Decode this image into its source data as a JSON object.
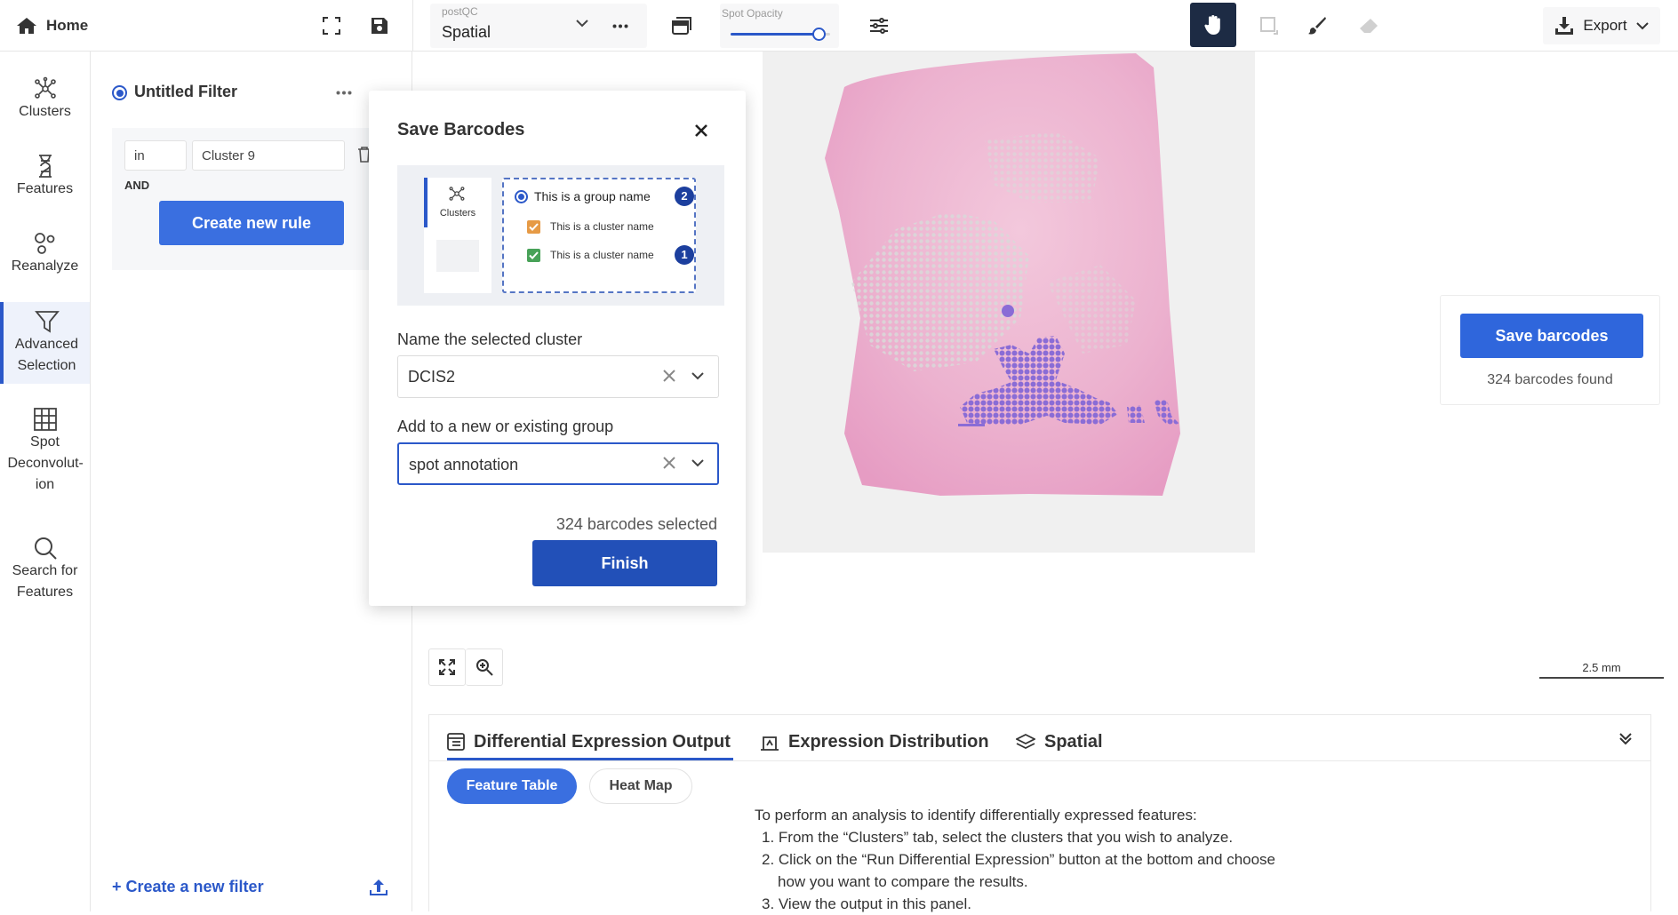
{
  "topbar": {
    "home_label": "Home",
    "dataset_caption": "postQC",
    "view_value": "Spatial",
    "spot_opacity_label": "Spot Opacity",
    "spot_opacity_level": 0.88,
    "export_label": "Export"
  },
  "leftnav": {
    "items": [
      {
        "label": "Clusters",
        "icon": "clusters-icon"
      },
      {
        "label": "Features",
        "icon": "features-icon"
      },
      {
        "label": "Reanalyze",
        "icon": "reanalyze-icon"
      },
      {
        "label": "Advanced Selection",
        "icon": "filter-icon"
      },
      {
        "label": "Spot Deconvolut-ion",
        "icon": "grid-icon"
      },
      {
        "label": "Search for Features",
        "icon": "search-icon"
      }
    ]
  },
  "filter": {
    "title": "Untitled Filter",
    "rule_operator": "in",
    "rule_value": "Cluster 9",
    "conjunction": "AND",
    "create_rule_label": "Create new rule",
    "create_filter_label": "+ Create a new filter"
  },
  "modal": {
    "title": "Save Barcodes",
    "illustration": {
      "tab_label": "Clusters",
      "group_name": "This is a group name",
      "cluster_name_1": "This is a cluster name",
      "cluster_name_2": "This is a cluster name",
      "badge_group": "2",
      "badge_cluster": "1"
    },
    "cluster_name_label": "Name the selected cluster",
    "cluster_name_value": "DCIS2",
    "group_label": "Add to a new or existing group",
    "group_value": "spot annotation",
    "selected_count": "324 barcodes selected",
    "finish_label": "Finish"
  },
  "save_card": {
    "button_label": "Save barcodes",
    "found_text": "324 barcodes found"
  },
  "scalebar": {
    "label": "2.5 mm"
  },
  "bottom": {
    "tabs": [
      {
        "label": "Differential Expression Output",
        "active": true
      },
      {
        "label": "Expression Distribution",
        "active": false
      },
      {
        "label": "Spatial",
        "active": false
      }
    ],
    "chips": [
      {
        "label": "Feature Table",
        "active": true
      },
      {
        "label": "Heat Map",
        "active": false
      }
    ],
    "instructions": {
      "intro": "To perform an analysis to identify differentially expressed features:",
      "step1": "1. From the “Clusters” tab, select the clusters that you wish to analyze.",
      "step2": "2. Click on the “Run Differential Expression” button at the bottom and choose",
      "step2b": "how you want to compare the results.",
      "step3": "3. View the output in this panel."
    }
  },
  "colors": {
    "accent": "#2b58c9",
    "button_blue": "#3a6fe0",
    "finish_blue": "#2250b8",
    "selection_purple": "#8a6cd6",
    "tissue_pink": "#e9a6c6"
  }
}
